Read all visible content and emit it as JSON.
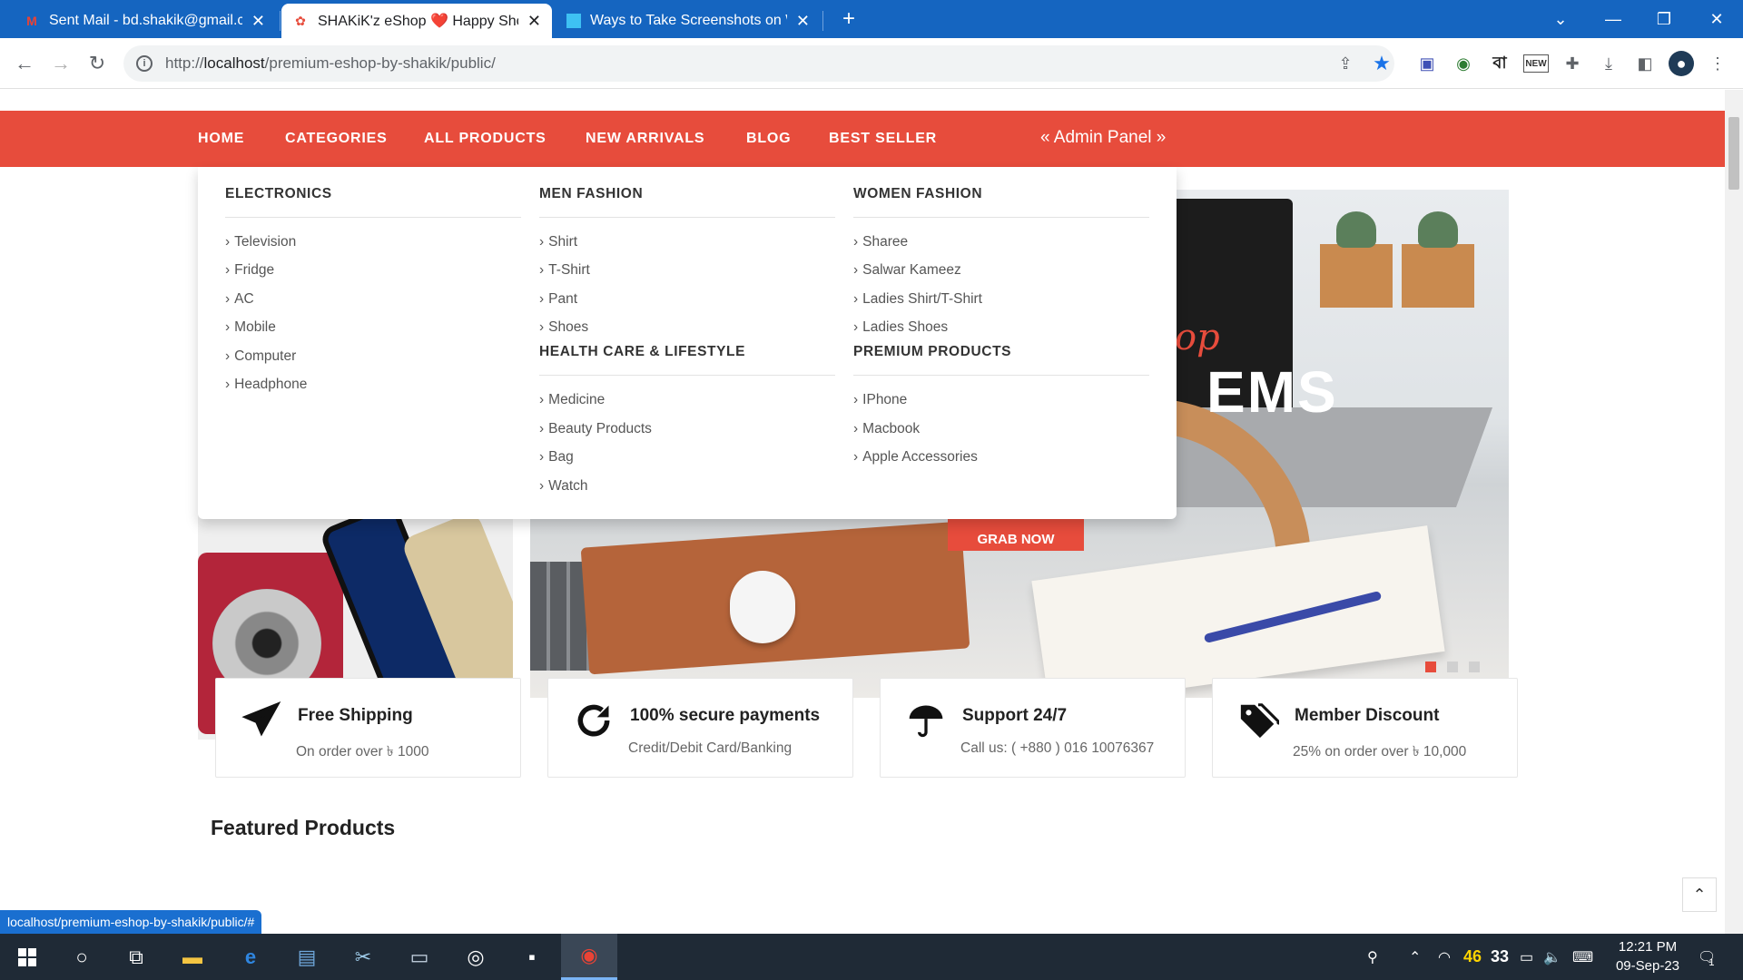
{
  "browser": {
    "tabs": [
      {
        "title": "Sent Mail - bd.shakik@gmail.com",
        "icon": "gmail-icon",
        "active": false
      },
      {
        "title": "SHAKiK'z eShop ❤️ Happy Shopping",
        "icon": "shop-icon",
        "active": true
      },
      {
        "title": "Ways to Take Screenshots on Windows",
        "icon": "article-icon",
        "active": false
      }
    ],
    "new_tab": "+",
    "url_prefix": "http://",
    "url_host": "localhost",
    "url_path": "/premium-eshop-by-shakik/public/",
    "status_url": "localhost/premium-eshop-by-shakik/public/#",
    "ext_bangla": "বা",
    "ext_new": "NEW"
  },
  "nav": {
    "items": [
      "HOME",
      "CATEGORIES",
      "ALL PRODUCTS",
      "NEW ARRIVALS",
      "BLOG",
      "BEST SELLER"
    ],
    "admin": "« Admin Panel »"
  },
  "megamenu": {
    "electronics": {
      "title": "ELECTRONICS",
      "items": [
        "Television",
        "Fridge",
        "AC",
        "Mobile",
        "Computer",
        "Headphone"
      ]
    },
    "men": {
      "title": "MEN FASHION",
      "items": [
        "Shirt",
        "T-Shirt",
        "Pant",
        "Shoes"
      ]
    },
    "women": {
      "title": "WOMEN FASHION",
      "items": [
        "Sharee",
        "Salwar Kameez",
        "Ladies Shirt/T-Shirt",
        "Ladies Shoes"
      ]
    },
    "health": {
      "title": "HEALTH CARE & LIFESTYLE",
      "items": [
        "Medicine",
        "Beauty Products",
        "Bag",
        "Watch"
      ]
    },
    "premium": {
      "title": "PREMIUM PRODUCTS",
      "items": [
        "IPhone",
        "Macbook",
        "Apple Accessories"
      ]
    }
  },
  "hero": {
    "text_script": "op",
    "text_big": "EMS",
    "button": "GRAB NOW"
  },
  "features": [
    {
      "title": "Free Shipping",
      "sub": "On order over ৳ 1000",
      "icon": "paper-plane-icon"
    },
    {
      "title": "100% secure payments",
      "sub": "Credit/Debit Card/Banking",
      "icon": "refresh-icon"
    },
    {
      "title": "Support 24/7",
      "sub": "Call us: ( +880 ) 016 10076367",
      "icon": "umbrella-icon"
    },
    {
      "title": "Member Discount",
      "sub": "25% on order over ৳ 10,000",
      "icon": "tags-icon"
    }
  ],
  "featured_heading": "Featured Products",
  "taskbar": {
    "temp1": "46",
    "temp2": "33",
    "time": "12:21 PM",
    "date": "09-Sep-23",
    "notif": "1"
  }
}
